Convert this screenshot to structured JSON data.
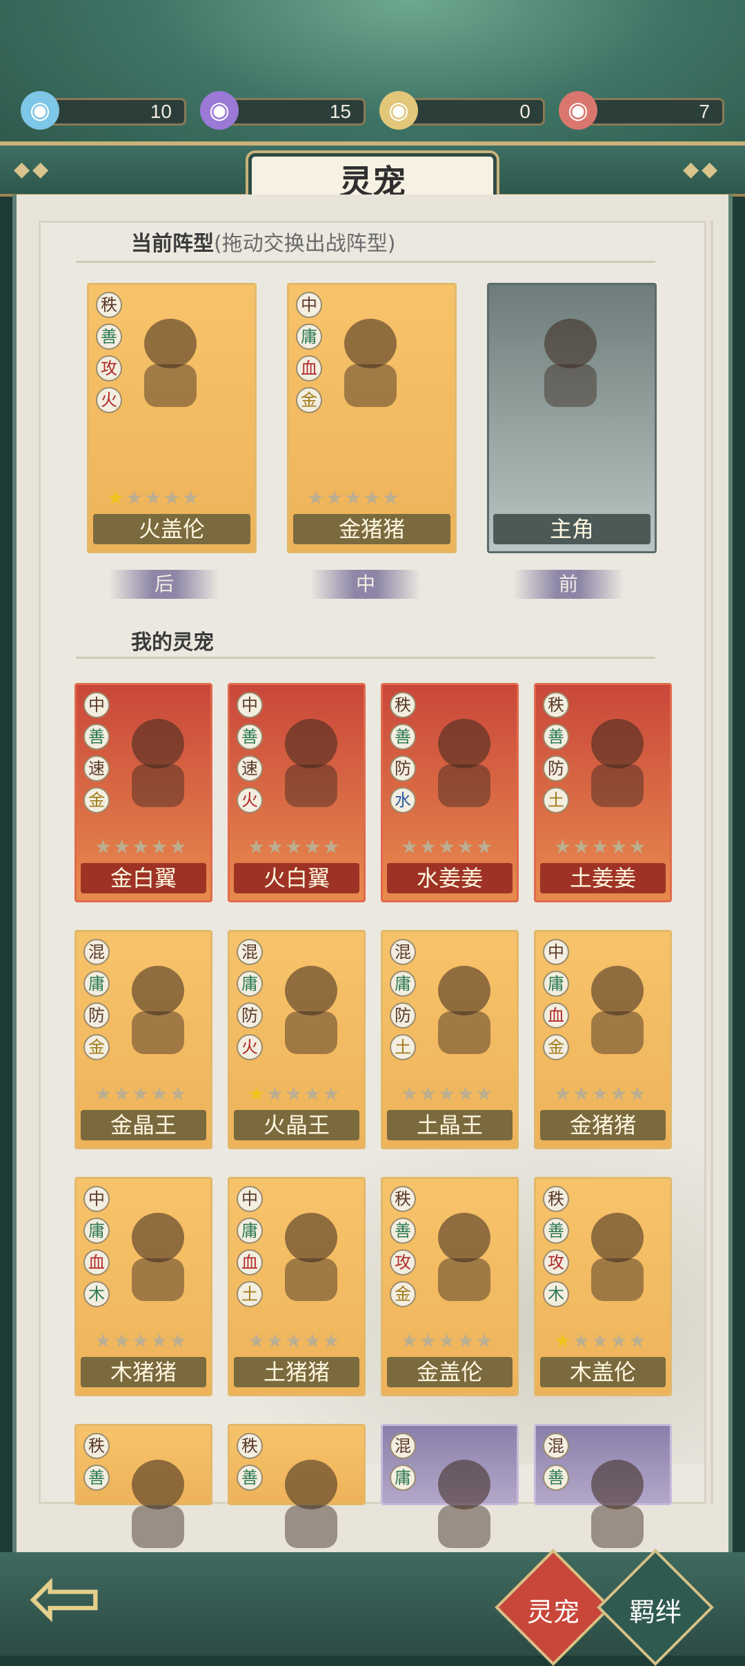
{
  "resources": [
    {
      "icon": "spirit-orb-blue-icon",
      "value": "10",
      "color": "#7ec6e6"
    },
    {
      "icon": "spirit-orb-purple-icon",
      "value": "15",
      "color": "#9a7ad6"
    },
    {
      "icon": "spirit-orb-gold-icon",
      "value": "0",
      "color": "#e2c77a"
    },
    {
      "icon": "spirit-orb-red-icon",
      "value": "7",
      "color": "#d9776e"
    }
  ],
  "header": {
    "title": "灵宠"
  },
  "formation": {
    "title": "当前阵型",
    "subtitle": "(拖动交换出战阵型)",
    "cards": [
      {
        "name": "火盖伦",
        "tags": [
          "秩",
          "善",
          "攻",
          "火"
        ],
        "stars": 1,
        "style": "gold"
      },
      {
        "name": "金猪猪",
        "tags": [
          "中",
          "庸",
          "血",
          "金"
        ],
        "stars": 0,
        "style": "gold"
      },
      {
        "name": "主角",
        "tags": [],
        "stars": 0,
        "style": "gray"
      }
    ],
    "positions": [
      "后",
      "中",
      "前"
    ]
  },
  "my_pets": {
    "title": "我的灵宠",
    "cards": [
      {
        "name": "金白翼",
        "tags": [
          "中",
          "善",
          "速",
          "金"
        ],
        "stars": 0,
        "style": "red"
      },
      {
        "name": "火白翼",
        "tags": [
          "中",
          "善",
          "速",
          "火"
        ],
        "stars": 0,
        "style": "red"
      },
      {
        "name": "水姜姜",
        "tags": [
          "秩",
          "善",
          "防",
          "水"
        ],
        "stars": 0,
        "style": "red"
      },
      {
        "name": "土姜姜",
        "tags": [
          "秩",
          "善",
          "防",
          "土"
        ],
        "stars": 0,
        "style": "red"
      },
      {
        "name": "金晶王",
        "tags": [
          "混",
          "庸",
          "防",
          "金"
        ],
        "stars": 0,
        "style": "gold"
      },
      {
        "name": "火晶王",
        "tags": [
          "混",
          "庸",
          "防",
          "火"
        ],
        "stars": 1,
        "style": "gold"
      },
      {
        "name": "土晶王",
        "tags": [
          "混",
          "庸",
          "防",
          "土"
        ],
        "stars": 0,
        "style": "gold"
      },
      {
        "name": "金猪猪",
        "tags": [
          "中",
          "庸",
          "血",
          "金"
        ],
        "stars": 0,
        "style": "gold"
      },
      {
        "name": "木猪猪",
        "tags": [
          "中",
          "庸",
          "血",
          "木"
        ],
        "stars": 0,
        "style": "gold"
      },
      {
        "name": "土猪猪",
        "tags": [
          "中",
          "庸",
          "血",
          "土"
        ],
        "stars": 0,
        "style": "gold"
      },
      {
        "name": "金盖伦",
        "tags": [
          "秩",
          "善",
          "攻",
          "金"
        ],
        "stars": 0,
        "style": "gold"
      },
      {
        "name": "木盖伦",
        "tags": [
          "秩",
          "善",
          "攻",
          "木"
        ],
        "stars": 1,
        "style": "gold"
      },
      {
        "name": "",
        "tags": [
          "秩",
          "善"
        ],
        "stars": 0,
        "style": "gold"
      },
      {
        "name": "",
        "tags": [
          "秩",
          "善"
        ],
        "stars": 0,
        "style": "gold"
      },
      {
        "name": "",
        "tags": [
          "混",
          "庸"
        ],
        "stars": 0,
        "style": "purple"
      },
      {
        "name": "",
        "tags": [
          "混",
          "善"
        ],
        "stars": 0,
        "style": "purple"
      }
    ]
  },
  "nav": {
    "back_icon": "back-arrow-icon",
    "tab_pets": "灵宠",
    "tab_bonds": "羁绊"
  },
  "colors": {
    "accent_red": "#c9473a",
    "accent_green": "#2f5a4f"
  }
}
